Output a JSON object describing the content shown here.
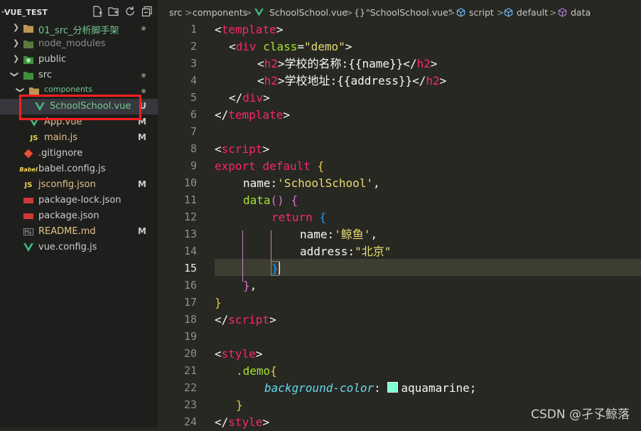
{
  "sidebar": {
    "title": "VUE_TEST",
    "items": [
      {
        "label": "01_src_分析脚手架",
        "color": "#73c991",
        "indicator": "dot",
        "badge": ""
      },
      {
        "label": "node_modules",
        "color": "#8b8b8b",
        "indicator": "",
        "badge": ""
      },
      {
        "label": "public",
        "color": "#cccccc",
        "indicator": "",
        "badge": ""
      },
      {
        "label": "src",
        "color": "#cccccc",
        "indicator": "dot",
        "badge": ""
      },
      {
        "label": "components",
        "color": "#73c991",
        "indicator": "dot",
        "badge": ""
      },
      {
        "label": "SchoolSchool.vue",
        "color": "#73c991",
        "indicator": "",
        "badge": "U"
      },
      {
        "label": "App.vue",
        "color": "#e2c08d",
        "indicator": "",
        "badge": "M"
      },
      {
        "label": "main.js",
        "color": "#e2c08d",
        "indicator": "",
        "badge": "M"
      },
      {
        "label": ".gitignore",
        "color": "#cccccc",
        "indicator": "",
        "badge": ""
      },
      {
        "label": "babel.config.js",
        "color": "#cccccc",
        "indicator": "",
        "badge": ""
      },
      {
        "label": "jsconfig.json",
        "color": "#e2c08d",
        "indicator": "",
        "badge": "M"
      },
      {
        "label": "package-lock.json",
        "color": "#cccccc",
        "indicator": "",
        "badge": ""
      },
      {
        "label": "package.json",
        "color": "#cccccc",
        "indicator": "",
        "badge": ""
      },
      {
        "label": "README.md",
        "color": "#e2c08d",
        "indicator": "",
        "badge": "M"
      },
      {
        "label": "vue.config.js",
        "color": "#cccccc",
        "indicator": "",
        "badge": ""
      }
    ]
  },
  "breadcrumb": {
    "src": "src",
    "components": "components",
    "file": "SchoolSchool.vue",
    "braces": "{}",
    "component": "\"SchoolSchool.vue\"",
    "script": "script",
    "default": "default",
    "data": "data",
    "sep": ">"
  },
  "editor": {
    "active_line": "15",
    "line_numbers": [
      "1",
      "2",
      "3",
      "4",
      "5",
      "6",
      "7",
      "8",
      "9",
      "10",
      "11",
      "12",
      "13",
      "14",
      "15",
      "16",
      "17",
      "18",
      "19",
      "20",
      "21",
      "22",
      "23",
      "24"
    ]
  },
  "code": {
    "l1": {
      "open": "<",
      "tag": "template",
      "close": ">"
    },
    "l2": {
      "open": "<",
      "tag": "div",
      "attr": "class",
      "eq": "=",
      "val": "\"demo\"",
      "close": ">"
    },
    "l3": {
      "open": "<",
      "tag": "h2",
      "mid": ">学校的名称:{{name}}</",
      "tag2": "h2",
      "close": ">"
    },
    "l4": {
      "open": "<",
      "tag": "h2",
      "mid": ">学校地址:{{address}}</",
      "tag2": "h2",
      "close": ">"
    },
    "l5": {
      "open": "</",
      "tag": "div",
      "close": ">"
    },
    "l6": {
      "open": "</",
      "tag": "template",
      "close": ">"
    },
    "l8": {
      "open": "<",
      "tag": "script",
      "close": ">"
    },
    "l9": {
      "kw1": "export",
      "kw2": "default",
      "brace": "{"
    },
    "l10": {
      "key": "name:",
      "val": "'SchoolSchool'",
      "comma": ","
    },
    "l11": {
      "fn": "data",
      "paren": "()",
      "brace": "{"
    },
    "l12": {
      "kw": "return",
      "brace": "{"
    },
    "l13": {
      "key": "name:",
      "val": "'鲸鱼'",
      "comma": ","
    },
    "l14": {
      "key": "address:",
      "val": "\"北京\""
    },
    "l15": {
      "brace": "}"
    },
    "l16": {
      "brace": "}",
      "comma": ","
    },
    "l17": {
      "brace": "}"
    },
    "l18": {
      "open": "</",
      "tag": "script",
      "close": ">"
    },
    "l20": {
      "open": "<",
      "tag": "style",
      "close": ">"
    },
    "l21": {
      "sel": ".demo",
      "brace": "{"
    },
    "l22": {
      "prop": "background-color",
      "colon": ":",
      "val": "aquamarine",
      "semi": ";",
      "swatch": "#7fffd4"
    },
    "l23": {
      "brace": "}"
    },
    "l24": {
      "open": "</",
      "tag": "style",
      "close": ">"
    }
  },
  "watermark": "CSDN @孑孓鲸落"
}
